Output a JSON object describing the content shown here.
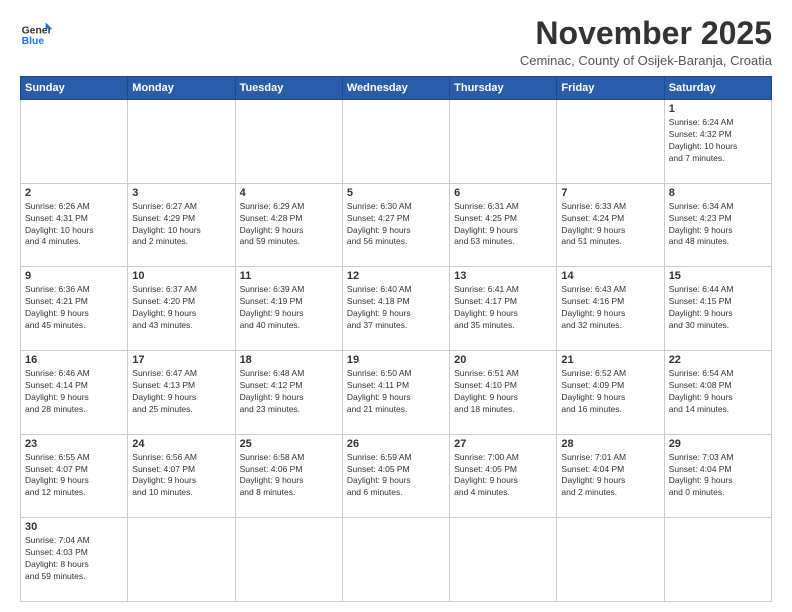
{
  "header": {
    "logo_general": "General",
    "logo_blue": "Blue",
    "month_title": "November 2025",
    "subtitle": "Ceminac, County of Osijek-Baranja, Croatia"
  },
  "weekdays": [
    "Sunday",
    "Monday",
    "Tuesday",
    "Wednesday",
    "Thursday",
    "Friday",
    "Saturday"
  ],
  "weeks": [
    [
      {
        "day": "",
        "info": ""
      },
      {
        "day": "",
        "info": ""
      },
      {
        "day": "",
        "info": ""
      },
      {
        "day": "",
        "info": ""
      },
      {
        "day": "",
        "info": ""
      },
      {
        "day": "",
        "info": ""
      },
      {
        "day": "1",
        "info": "Sunrise: 6:24 AM\nSunset: 4:32 PM\nDaylight: 10 hours\nand 7 minutes."
      }
    ],
    [
      {
        "day": "2",
        "info": "Sunrise: 6:26 AM\nSunset: 4:31 PM\nDaylight: 10 hours\nand 4 minutes."
      },
      {
        "day": "3",
        "info": "Sunrise: 6:27 AM\nSunset: 4:29 PM\nDaylight: 10 hours\nand 2 minutes."
      },
      {
        "day": "4",
        "info": "Sunrise: 6:29 AM\nSunset: 4:28 PM\nDaylight: 9 hours\nand 59 minutes."
      },
      {
        "day": "5",
        "info": "Sunrise: 6:30 AM\nSunset: 4:27 PM\nDaylight: 9 hours\nand 56 minutes."
      },
      {
        "day": "6",
        "info": "Sunrise: 6:31 AM\nSunset: 4:25 PM\nDaylight: 9 hours\nand 53 minutes."
      },
      {
        "day": "7",
        "info": "Sunrise: 6:33 AM\nSunset: 4:24 PM\nDaylight: 9 hours\nand 51 minutes."
      },
      {
        "day": "8",
        "info": "Sunrise: 6:34 AM\nSunset: 4:23 PM\nDaylight: 9 hours\nand 48 minutes."
      }
    ],
    [
      {
        "day": "9",
        "info": "Sunrise: 6:36 AM\nSunset: 4:21 PM\nDaylight: 9 hours\nand 45 minutes."
      },
      {
        "day": "10",
        "info": "Sunrise: 6:37 AM\nSunset: 4:20 PM\nDaylight: 9 hours\nand 43 minutes."
      },
      {
        "day": "11",
        "info": "Sunrise: 6:39 AM\nSunset: 4:19 PM\nDaylight: 9 hours\nand 40 minutes."
      },
      {
        "day": "12",
        "info": "Sunrise: 6:40 AM\nSunset: 4:18 PM\nDaylight: 9 hours\nand 37 minutes."
      },
      {
        "day": "13",
        "info": "Sunrise: 6:41 AM\nSunset: 4:17 PM\nDaylight: 9 hours\nand 35 minutes."
      },
      {
        "day": "14",
        "info": "Sunrise: 6:43 AM\nSunset: 4:16 PM\nDaylight: 9 hours\nand 32 minutes."
      },
      {
        "day": "15",
        "info": "Sunrise: 6:44 AM\nSunset: 4:15 PM\nDaylight: 9 hours\nand 30 minutes."
      }
    ],
    [
      {
        "day": "16",
        "info": "Sunrise: 6:46 AM\nSunset: 4:14 PM\nDaylight: 9 hours\nand 28 minutes."
      },
      {
        "day": "17",
        "info": "Sunrise: 6:47 AM\nSunset: 4:13 PM\nDaylight: 9 hours\nand 25 minutes."
      },
      {
        "day": "18",
        "info": "Sunrise: 6:48 AM\nSunset: 4:12 PM\nDaylight: 9 hours\nand 23 minutes."
      },
      {
        "day": "19",
        "info": "Sunrise: 6:50 AM\nSunset: 4:11 PM\nDaylight: 9 hours\nand 21 minutes."
      },
      {
        "day": "20",
        "info": "Sunrise: 6:51 AM\nSunset: 4:10 PM\nDaylight: 9 hours\nand 18 minutes."
      },
      {
        "day": "21",
        "info": "Sunrise: 6:52 AM\nSunset: 4:09 PM\nDaylight: 9 hours\nand 16 minutes."
      },
      {
        "day": "22",
        "info": "Sunrise: 6:54 AM\nSunset: 4:08 PM\nDaylight: 9 hours\nand 14 minutes."
      }
    ],
    [
      {
        "day": "23",
        "info": "Sunrise: 6:55 AM\nSunset: 4:07 PM\nDaylight: 9 hours\nand 12 minutes."
      },
      {
        "day": "24",
        "info": "Sunrise: 6:56 AM\nSunset: 4:07 PM\nDaylight: 9 hours\nand 10 minutes."
      },
      {
        "day": "25",
        "info": "Sunrise: 6:58 AM\nSunset: 4:06 PM\nDaylight: 9 hours\nand 8 minutes."
      },
      {
        "day": "26",
        "info": "Sunrise: 6:59 AM\nSunset: 4:05 PM\nDaylight: 9 hours\nand 6 minutes."
      },
      {
        "day": "27",
        "info": "Sunrise: 7:00 AM\nSunset: 4:05 PM\nDaylight: 9 hours\nand 4 minutes."
      },
      {
        "day": "28",
        "info": "Sunrise: 7:01 AM\nSunset: 4:04 PM\nDaylight: 9 hours\nand 2 minutes."
      },
      {
        "day": "29",
        "info": "Sunrise: 7:03 AM\nSunset: 4:04 PM\nDaylight: 9 hours\nand 0 minutes."
      }
    ],
    [
      {
        "day": "30",
        "info": "Sunrise: 7:04 AM\nSunset: 4:03 PM\nDaylight: 8 hours\nand 59 minutes."
      },
      {
        "day": "",
        "info": ""
      },
      {
        "day": "",
        "info": ""
      },
      {
        "day": "",
        "info": ""
      },
      {
        "day": "",
        "info": ""
      },
      {
        "day": "",
        "info": ""
      },
      {
        "day": "",
        "info": ""
      }
    ]
  ]
}
